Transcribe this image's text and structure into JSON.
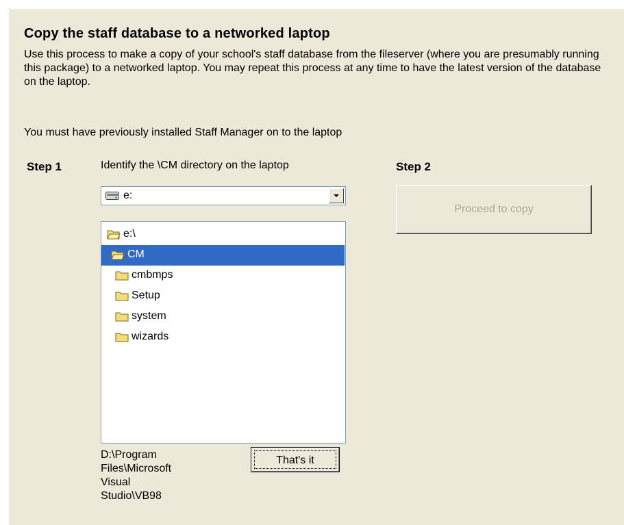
{
  "title": "Copy the staff database to a networked laptop",
  "intro": "Use this process to make a copy of your school's staff database from the fileserver (where you are presumably running this package) to a networked laptop.  You may repeat this process at any time to have the latest version of the database on the laptop.",
  "prerequisite": "You must have previously installed Staff Manager on to the laptop",
  "step1": {
    "label": "Step 1",
    "description": "Identify the \\CM directory on the laptop",
    "drive": {
      "value": "e:",
      "icon": "drive-icon"
    },
    "directories": [
      {
        "name": "e:\\",
        "icon": "open-folder-icon",
        "selected": false
      },
      {
        "name": "CM",
        "icon": "open-folder-icon",
        "selected": true
      },
      {
        "name": "cmbmps",
        "icon": "folder-icon",
        "selected": false
      },
      {
        "name": "Setup",
        "icon": "folder-icon",
        "selected": false
      },
      {
        "name": "system",
        "icon": "folder-icon",
        "selected": false
      },
      {
        "name": "wizards",
        "icon": "folder-icon",
        "selected": false
      }
    ],
    "current_path": "D:\\Program Files\\Microsoft Visual Studio\\VB98",
    "confirm_button": "That's it"
  },
  "step2": {
    "label": "Step 2",
    "button": "Proceed to copy",
    "button_enabled": false
  },
  "colors": {
    "background": "#ece9d8",
    "selection": "#316ac5",
    "disabled_text": "#aca899"
  }
}
